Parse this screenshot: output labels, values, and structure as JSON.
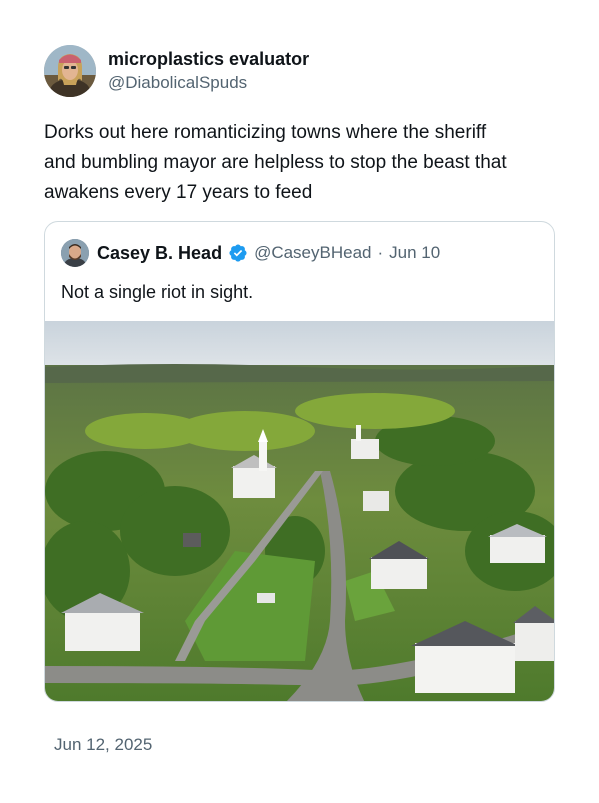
{
  "tweet": {
    "author": {
      "display_name": "microplastics evaluator",
      "handle": "@DiabolicalSpuds",
      "avatar_icon": "user-avatar-photo"
    },
    "text_lines": [
      "Dorks out here romanticizing towns where the sheriff",
      "and bumbling mayor are helpless to stop the beast that",
      "awakens every 17 years to feed"
    ],
    "timestamp": "Jun 12, 2025"
  },
  "quoted": {
    "display_name": "Casey B. Head",
    "handle": "@CaseyBHead",
    "separator": "·",
    "date": "Jun 10",
    "text": "Not a single riot in sight.",
    "verified": true,
    "verified_color": "#1d9bf0",
    "image_icon": "aerial-town-photo"
  }
}
